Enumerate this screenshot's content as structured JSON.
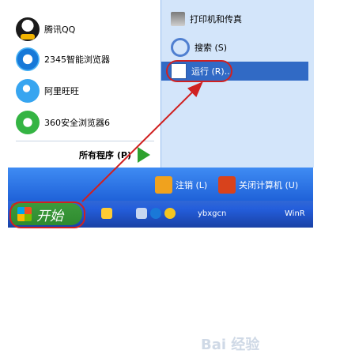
{
  "left_items": [
    {
      "label": "腾讯QQ",
      "icon": "qq-icon"
    },
    {
      "label": "2345智能浏览器",
      "icon": "ie-icon"
    },
    {
      "label": "阿里旺旺",
      "icon": "wangwang-icon"
    },
    {
      "label": "360安全浏览器6",
      "icon": "360-browser-icon"
    }
  ],
  "all_programs": "所有程序 (P)",
  "right_items": {
    "printer": "打印机和传真",
    "search": "搜索 (S)",
    "run": "运行 (R)..."
  },
  "bottom": {
    "logoff": "注销 (L)",
    "shutdown": "关闭计算机 (U)"
  },
  "taskbar": {
    "start": "开始",
    "item1": "ybxgcn",
    "item2": "WinR"
  },
  "watermark": "Bai 经验"
}
